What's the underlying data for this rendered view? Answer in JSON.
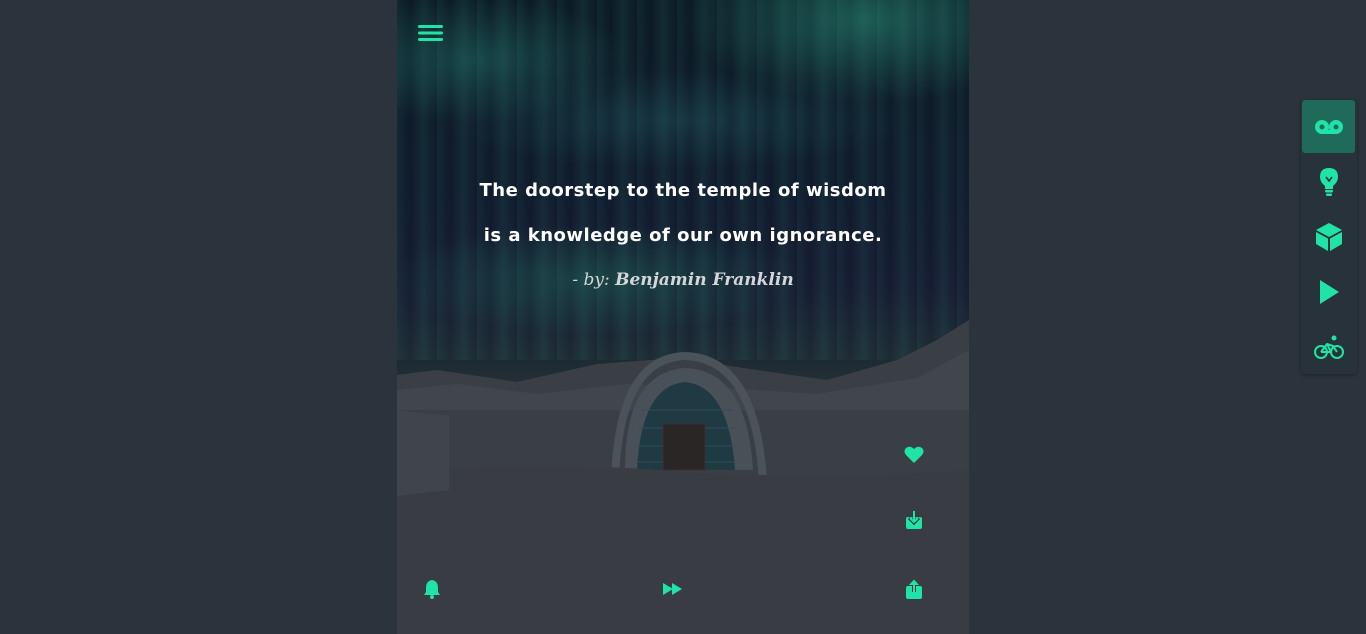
{
  "quote": {
    "text": "The doorstep to the temple of wisdom is a knowledge of our own ignorance.",
    "author_prefix": "- by:",
    "author_name": "Benjamin Franklin"
  },
  "colors": {
    "accent": "#20e3a6",
    "page_background": "#2b343c",
    "side_active": "#1f6a58"
  },
  "icons": {
    "menu": "hamburger-menu-icon",
    "like": "heart-icon",
    "download": "download-icon",
    "notifications": "bell-icon",
    "next": "fast-forward-icon",
    "share": "share-icon"
  },
  "side_nav": [
    {
      "icon": "voicemail-icon",
      "active": true
    },
    {
      "icon": "lightbulb-icon",
      "active": false
    },
    {
      "icon": "cube-icon",
      "active": false
    },
    {
      "icon": "play-icon",
      "active": false
    },
    {
      "icon": "bicycle-icon",
      "active": false
    }
  ]
}
